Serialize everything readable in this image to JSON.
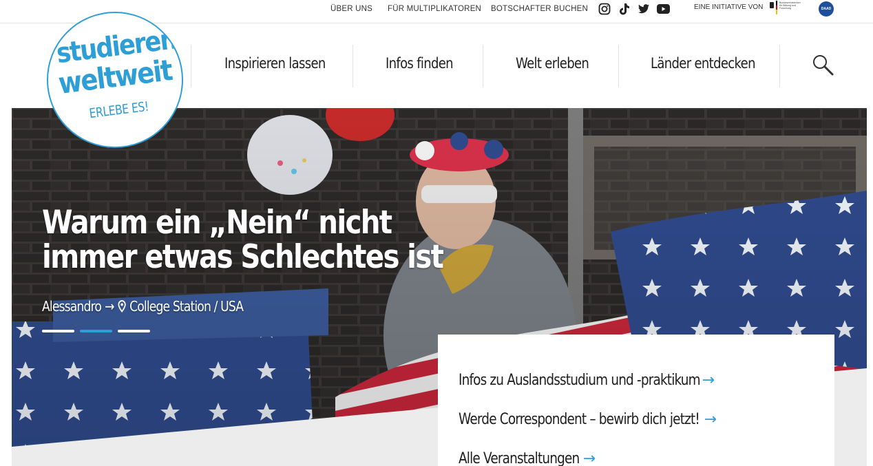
{
  "topbar": {
    "links": [
      "ÜBER UNS",
      "FÜR MULTIPLIKATOREN",
      "BOTSCHAFTER BUCHEN"
    ],
    "social_icons": [
      "instagram-icon",
      "tiktok-icon",
      "twitter-icon",
      "youtube-icon"
    ],
    "initiative_label": "EINE INITIATIVE VON",
    "bmbf_logo_text": "Bundesministerium für Bildung und Forschung",
    "daad_logo_text": "DAAD"
  },
  "logo": {
    "line1": "studieren",
    "line2": "weltweit",
    "tagline": "ERLEBE ES!"
  },
  "nav": {
    "items": [
      "Inspirieren lassen",
      "Infos finden",
      "Welt erleben",
      "Länder entdecken"
    ],
    "search_icon": "search-icon"
  },
  "hero": {
    "title": "Warum ein „Nein“ nicht immer etwas Schlechtes ist",
    "author": "Alessandro",
    "arrow": "→",
    "location": "College Station / USA",
    "slide_count": 3,
    "active_slide": 2
  },
  "panel": {
    "links": [
      "Infos zu Auslandsstudium und -praktikum",
      "Werde Correspondent – bewirb dich jetzt!",
      "Alle Veranstaltungen"
    ],
    "arrow": "→"
  },
  "colors": {
    "accent": "#2e9fd6",
    "text": "#1f1f1f",
    "daad": "#1d4f9c"
  }
}
